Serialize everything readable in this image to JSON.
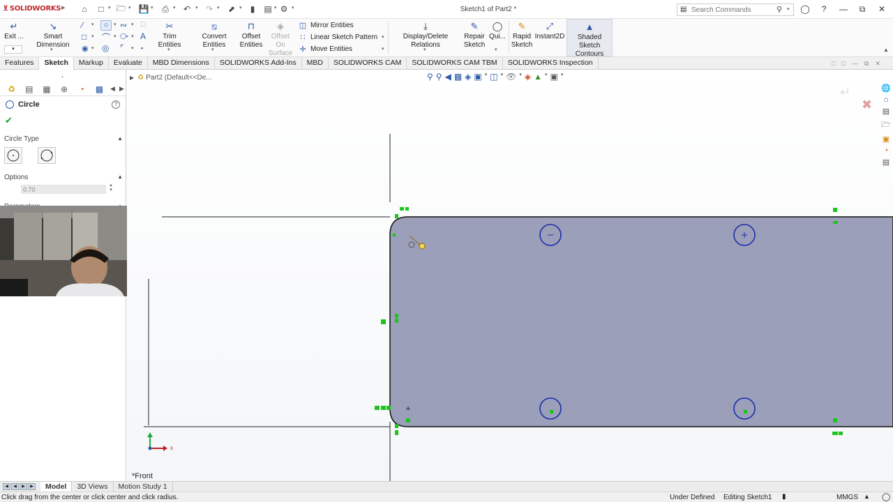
{
  "app": {
    "logo": "SOLIDWORKS",
    "document_title": "Sketch1 of Part2 *"
  },
  "search": {
    "placeholder": "Search Commands"
  },
  "ribbon": {
    "exit": "Exit ...",
    "smart_dimension": "Smart Dimension",
    "trim_entities": "Trim Entities",
    "convert_entities": "Convert Entities",
    "offset_entities": "Offset Entities",
    "offset_on_surface": "Offset On Surface",
    "mirror_entities": "Mirror Entities",
    "linear_sketch_pattern": "Linear Sketch Pattern",
    "move_entities": "Move Entities",
    "display_delete_relations": "Display/Delete Relations",
    "repair_sketch": "Repair Sketch",
    "quick_snaps": "Qui...",
    "rapid_sketch": "Rapid Sketch",
    "instant2d": "Instant2D",
    "shaded_sketch_contours": "Shaded Sketch Contours"
  },
  "tabs": [
    "Features",
    "Sketch",
    "Markup",
    "Evaluate",
    "MBD Dimensions",
    "SOLIDWORKS Add-Ins",
    "MBD",
    "SOLIDWORKS CAM",
    "SOLIDWORKS CAM TBM",
    "SOLIDWORKS Inspection"
  ],
  "active_tab": "Sketch",
  "property_manager": {
    "title": "Circle",
    "circle_type_label": "Circle Type",
    "options_label": "Options",
    "options_value": "0.70",
    "parameters_label": "Parameters"
  },
  "graphics": {
    "tree_path": "Part2 (Default<<De...",
    "view_label": "*Front",
    "triad_x": "x"
  },
  "bottom_tabs": [
    "Model",
    "3D Views",
    "Motion Study 1"
  ],
  "status": {
    "hint": "Click drag from the center or click center and click radius.",
    "definition": "Under Defined",
    "editing": "Editing Sketch1",
    "units": "MMGS"
  },
  "colors": {
    "accent": "#2b5aa7",
    "sketch_fill": "#9b9fb9",
    "relation_green": "#1ec41e",
    "brand_red": "#c0282d"
  }
}
